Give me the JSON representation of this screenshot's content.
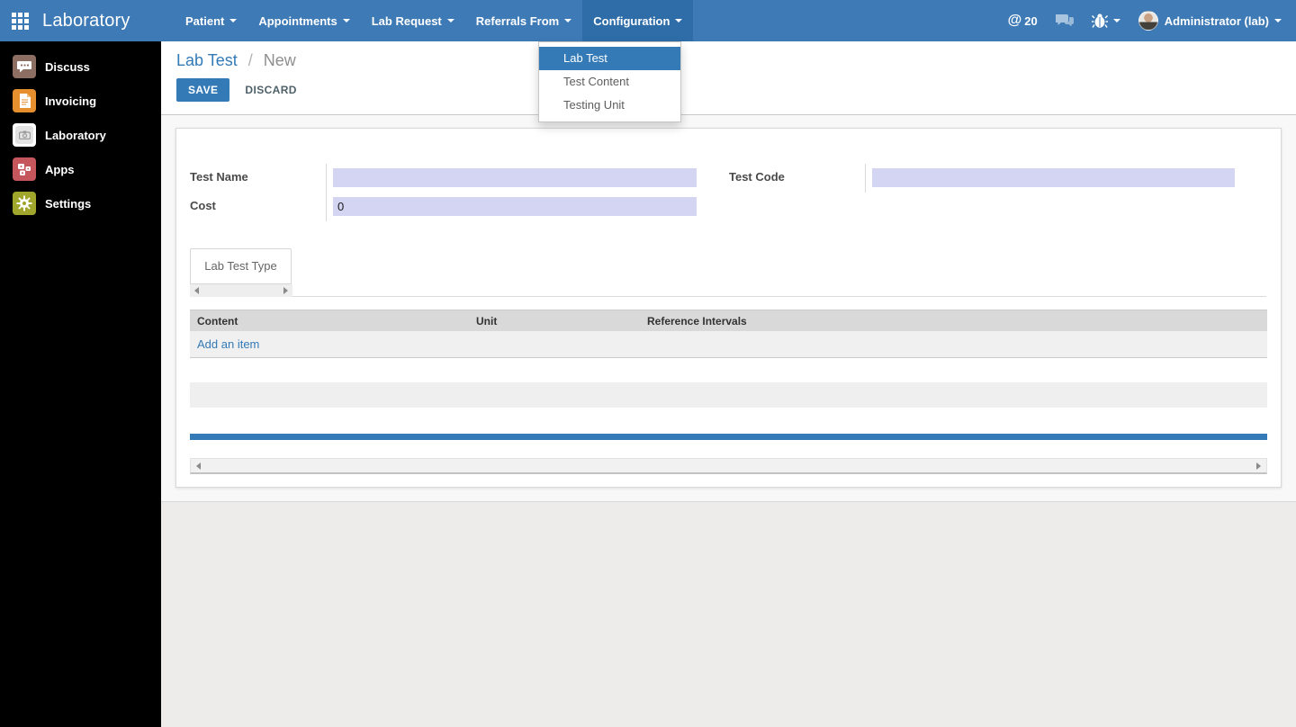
{
  "colors": {
    "navbar": "#3d7ab6",
    "navbar_active": "#2f6da8",
    "accent": "#337ab7",
    "required_field_bg": "#d4d5f2",
    "sidebar_bg": "#000000"
  },
  "navbar": {
    "brand": "Laboratory",
    "menus": [
      {
        "label": "Patient"
      },
      {
        "label": "Appointments"
      },
      {
        "label": "Lab Request"
      },
      {
        "label": "Referrals From"
      },
      {
        "label": "Configuration"
      }
    ],
    "right": {
      "mention_symbol": "@",
      "mention_count": "20",
      "user": "Administrator (lab)"
    }
  },
  "config_dropdown": {
    "items": [
      {
        "label": "Lab Test"
      },
      {
        "label": "Test Content"
      },
      {
        "label": "Testing Unit"
      }
    ]
  },
  "sidebar": {
    "items": [
      {
        "label": "Discuss"
      },
      {
        "label": "Invoicing"
      },
      {
        "label": "Laboratory"
      },
      {
        "label": "Apps"
      },
      {
        "label": "Settings"
      }
    ]
  },
  "breadcrumb": {
    "parent": "Lab Test",
    "separator": "/",
    "current": "New"
  },
  "actions": {
    "save": "SAVE",
    "discard": "DISCARD"
  },
  "form": {
    "test_name": {
      "label": "Test Name",
      "value": ""
    },
    "test_code": {
      "label": "Test Code",
      "value": ""
    },
    "cost": {
      "label": "Cost",
      "value": "0"
    }
  },
  "notebook": {
    "tab": "Lab Test Type"
  },
  "lines_table": {
    "columns": [
      "Content",
      "Unit",
      "Reference Intervals"
    ],
    "add_label": "Add an item"
  },
  "icons": {
    "apps_grid": "3x3-grid",
    "mention": "@",
    "chat": "speech-bubbles",
    "debug": "bug",
    "caret": "triangle-down",
    "scroll_left": "triangle-left",
    "scroll_right": "triangle-right"
  }
}
